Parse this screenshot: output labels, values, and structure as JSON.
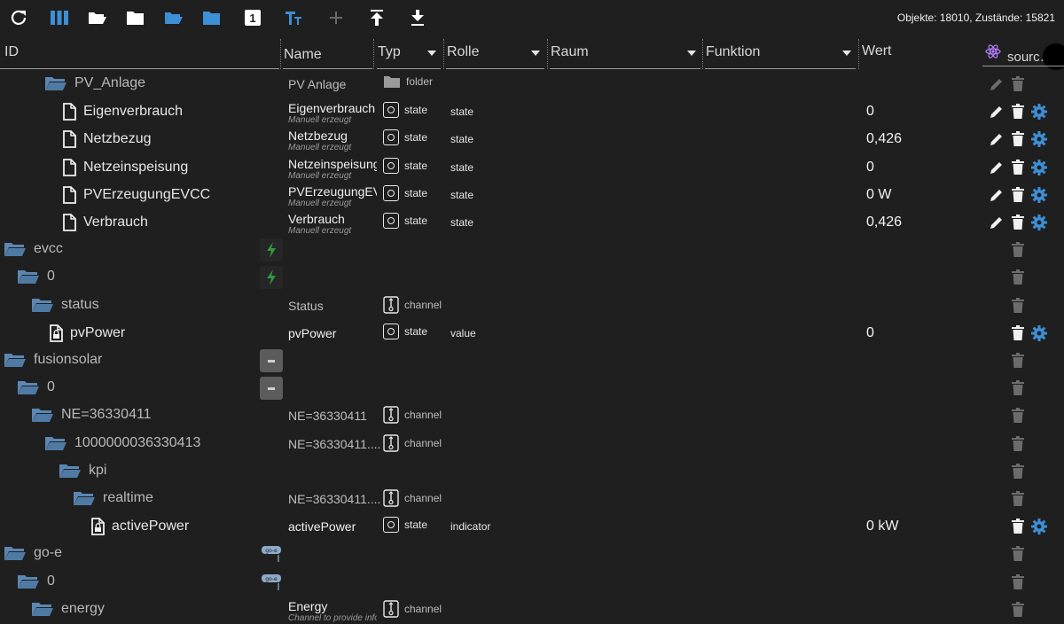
{
  "toolbar": {
    "buttons": [
      "refresh-icon",
      "columns-icon",
      "folder-open-icon",
      "folder-icon",
      "folder-open-blue-icon",
      "folder-blue-icon",
      "one-icon",
      "text-size-icon",
      "add-icon",
      "upload-icon",
      "download-icon"
    ],
    "one_label": "1",
    "counts": "Objekte: 18010, Zustände: 15821"
  },
  "header": {
    "id": "ID",
    "name": "Name",
    "typ": "Typ",
    "rolle": "Rolle",
    "raum": "Raum",
    "funktion": "Funktion",
    "wert": "Wert",
    "source": "sourc…"
  },
  "rows": [
    {
      "id": "PV_Anlage",
      "name": "PV Anlage",
      "type": "folder"
    },
    {
      "id": "Eigenverbrauch",
      "name": "Eigenverbrauch",
      "sub": "Manuell erzeugt",
      "type": "state",
      "role": "state",
      "value": "0"
    },
    {
      "id": "Netzbezug",
      "name": "Netzbezug",
      "sub": "Manuell erzeugt",
      "type": "state",
      "role": "state",
      "value": "0,426"
    },
    {
      "id": "Netzeinspeisung",
      "name": "Netzeinspeisung",
      "sub": "Manuell erzeugt",
      "type": "state",
      "role": "state",
      "value": "0"
    },
    {
      "id": "PVErzeugungEVCC",
      "name": "PVErzeugungEVCC",
      "sub": "Manuell erzeugt",
      "type": "state",
      "role": "state",
      "value": "0 W"
    },
    {
      "id": "Verbrauch",
      "name": "Verbrauch",
      "sub": "Manuell erzeugt",
      "type": "state",
      "role": "state",
      "value": "0,426"
    },
    {
      "id": "evcc"
    },
    {
      "id": "0"
    },
    {
      "id": "status",
      "name": "Status",
      "type": "channel"
    },
    {
      "id": "pvPower",
      "name": "pvPower",
      "type": "state",
      "role": "value",
      "value": "0"
    },
    {
      "id": "fusionsolar"
    },
    {
      "id": "0"
    },
    {
      "id": "NE=36330411",
      "name": "NE=36330411",
      "type": "channel"
    },
    {
      "id": "1000000036330413",
      "name": "NE=36330411....",
      "type": "channel"
    },
    {
      "id": "kpi"
    },
    {
      "id": "realtime",
      "name": "NE=36330411....",
      "type": "channel"
    },
    {
      "id": "activePower",
      "name": "activePower",
      "type": "state",
      "role": "indicator",
      "value": "0 kW"
    },
    {
      "id": "go-e"
    },
    {
      "id": "0"
    },
    {
      "id": "energy",
      "name": "Energy",
      "sub": "Channel to provide infor",
      "type": "channel"
    }
  ],
  "colors": {
    "accent": "#3d8fd6",
    "background": "#1f1f1f",
    "evcc": "#2f8f2f"
  }
}
